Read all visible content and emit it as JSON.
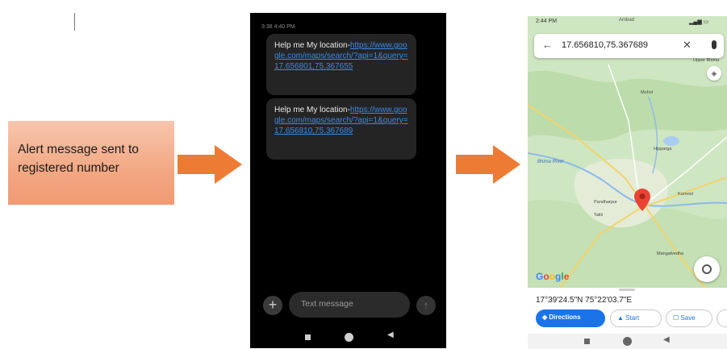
{
  "alert_box": {
    "line1": "Alert message sent to",
    "line2": "registered number"
  },
  "sms_screen": {
    "timestamp": "3:38 4:40 PM",
    "messages": [
      {
        "lead": "Help me My location-",
        "link": "https://www.google.com/maps/search/?api=1&query=17.656801,75.367655"
      },
      {
        "lead": "Help me My location-",
        "link": "https://www.google.com/maps/search/?api=1&query=17.656810,75.367689"
      }
    ],
    "input_placeholder": "Text message",
    "plus_icon": "+",
    "send_icon": "↑"
  },
  "maps_screen": {
    "status_time": "2:44 PM",
    "status_town": "Ambad",
    "search_text": "17.656810,75.367689",
    "river_label": "Bhima River",
    "places": [
      "Upper Bhima",
      "Mohol",
      "Hipparga",
      "Pandharpur",
      "Takli",
      "Mangalvedha",
      "Kurnool"
    ],
    "google_logo": "Google",
    "coordinates": "17°39'24.5\"N 75°22'03.7\"E",
    "actions": {
      "directions": "Directions",
      "start": "Start",
      "save": "Save"
    },
    "colors": {
      "primary": "#1a73e8",
      "pin": "#ea4335",
      "map_land": "#cfe6c2"
    }
  },
  "colors": {
    "arrow": "#ee7b34",
    "alert_box": "#f3a782",
    "sms_link": "#3d8ae6"
  }
}
